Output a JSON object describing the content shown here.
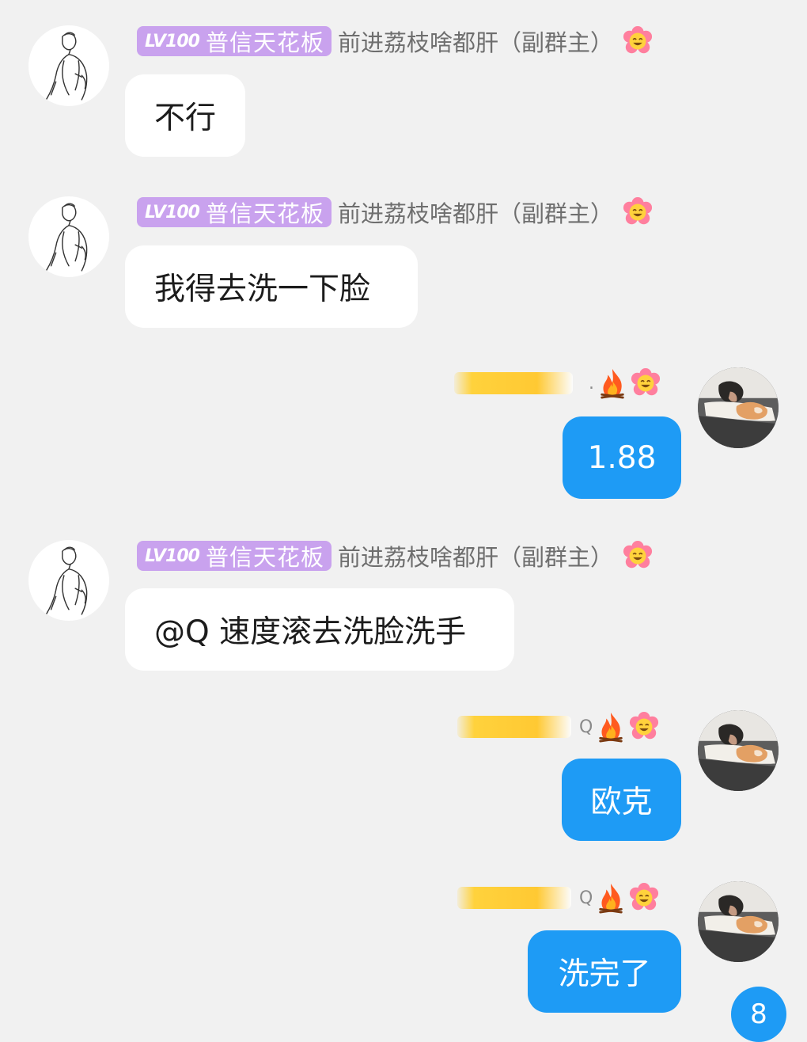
{
  "messages": [
    {
      "direction": "incoming",
      "sender": {
        "level": "LV100",
        "title": "普信天花板",
        "name": "前进荔枝啥都肝（副群主）"
      },
      "text": "不行"
    },
    {
      "direction": "incoming",
      "sender": {
        "level": "LV100",
        "title": "普信天花板",
        "name": "前进荔枝啥都肝（副群主）"
      },
      "text": "我得去洗一下脸"
    },
    {
      "direction": "outgoing",
      "sender": {
        "name_suffix": "."
      },
      "text": "1.88"
    },
    {
      "direction": "incoming",
      "sender": {
        "level": "LV100",
        "title": "普信天花板",
        "name": "前进荔枝啥都肝（副群主）"
      },
      "text": "@Q 速度滚去洗脸洗手"
    },
    {
      "direction": "outgoing",
      "sender": {
        "name_suffix": "Q"
      },
      "text": "欧克"
    },
    {
      "direction": "outgoing",
      "sender": {
        "name_suffix": "Q"
      },
      "text": "洗完了"
    }
  ],
  "unread_badge": "8",
  "colors": {
    "background": "#f1f1f1",
    "incoming_bubble": "#ffffff",
    "outgoing_bubble": "#1e9bf5",
    "level_badge": "#c9a2ee",
    "unread_badge": "#1e9bf5"
  },
  "icons": [
    "flower-emoji-icon",
    "fire-emoji-icon",
    "sketch-avatar",
    "photo-avatar"
  ]
}
